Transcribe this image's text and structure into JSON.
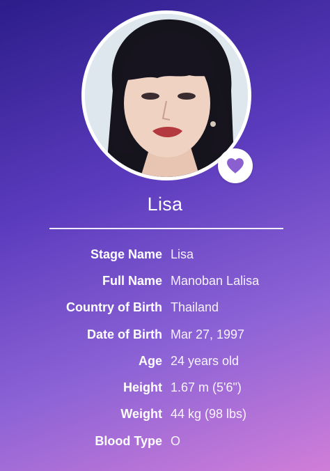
{
  "profile": {
    "name": "Lisa",
    "favorite_icon": "heart-icon",
    "photo": "profile-photo"
  },
  "info": [
    {
      "label": "Stage Name",
      "value": "Lisa"
    },
    {
      "label": "Full Name",
      "value": "Manoban Lalisa"
    },
    {
      "label": "Country of Birth",
      "value": "Thailand"
    },
    {
      "label": "Date of Birth",
      "value": "Mar 27, 1997"
    },
    {
      "label": "Age",
      "value": "24 years old"
    },
    {
      "label": "Height",
      "value": "1.67 m (5'6\")"
    },
    {
      "label": "Weight",
      "value": "44 kg (98 lbs)"
    },
    {
      "label": "Blood Type",
      "value": "O"
    }
  ],
  "colors": {
    "gradient_start": "#2c1d8a",
    "gradient_end": "#d07ed8",
    "heart": "#8a5fd0",
    "text": "#ffffff"
  }
}
